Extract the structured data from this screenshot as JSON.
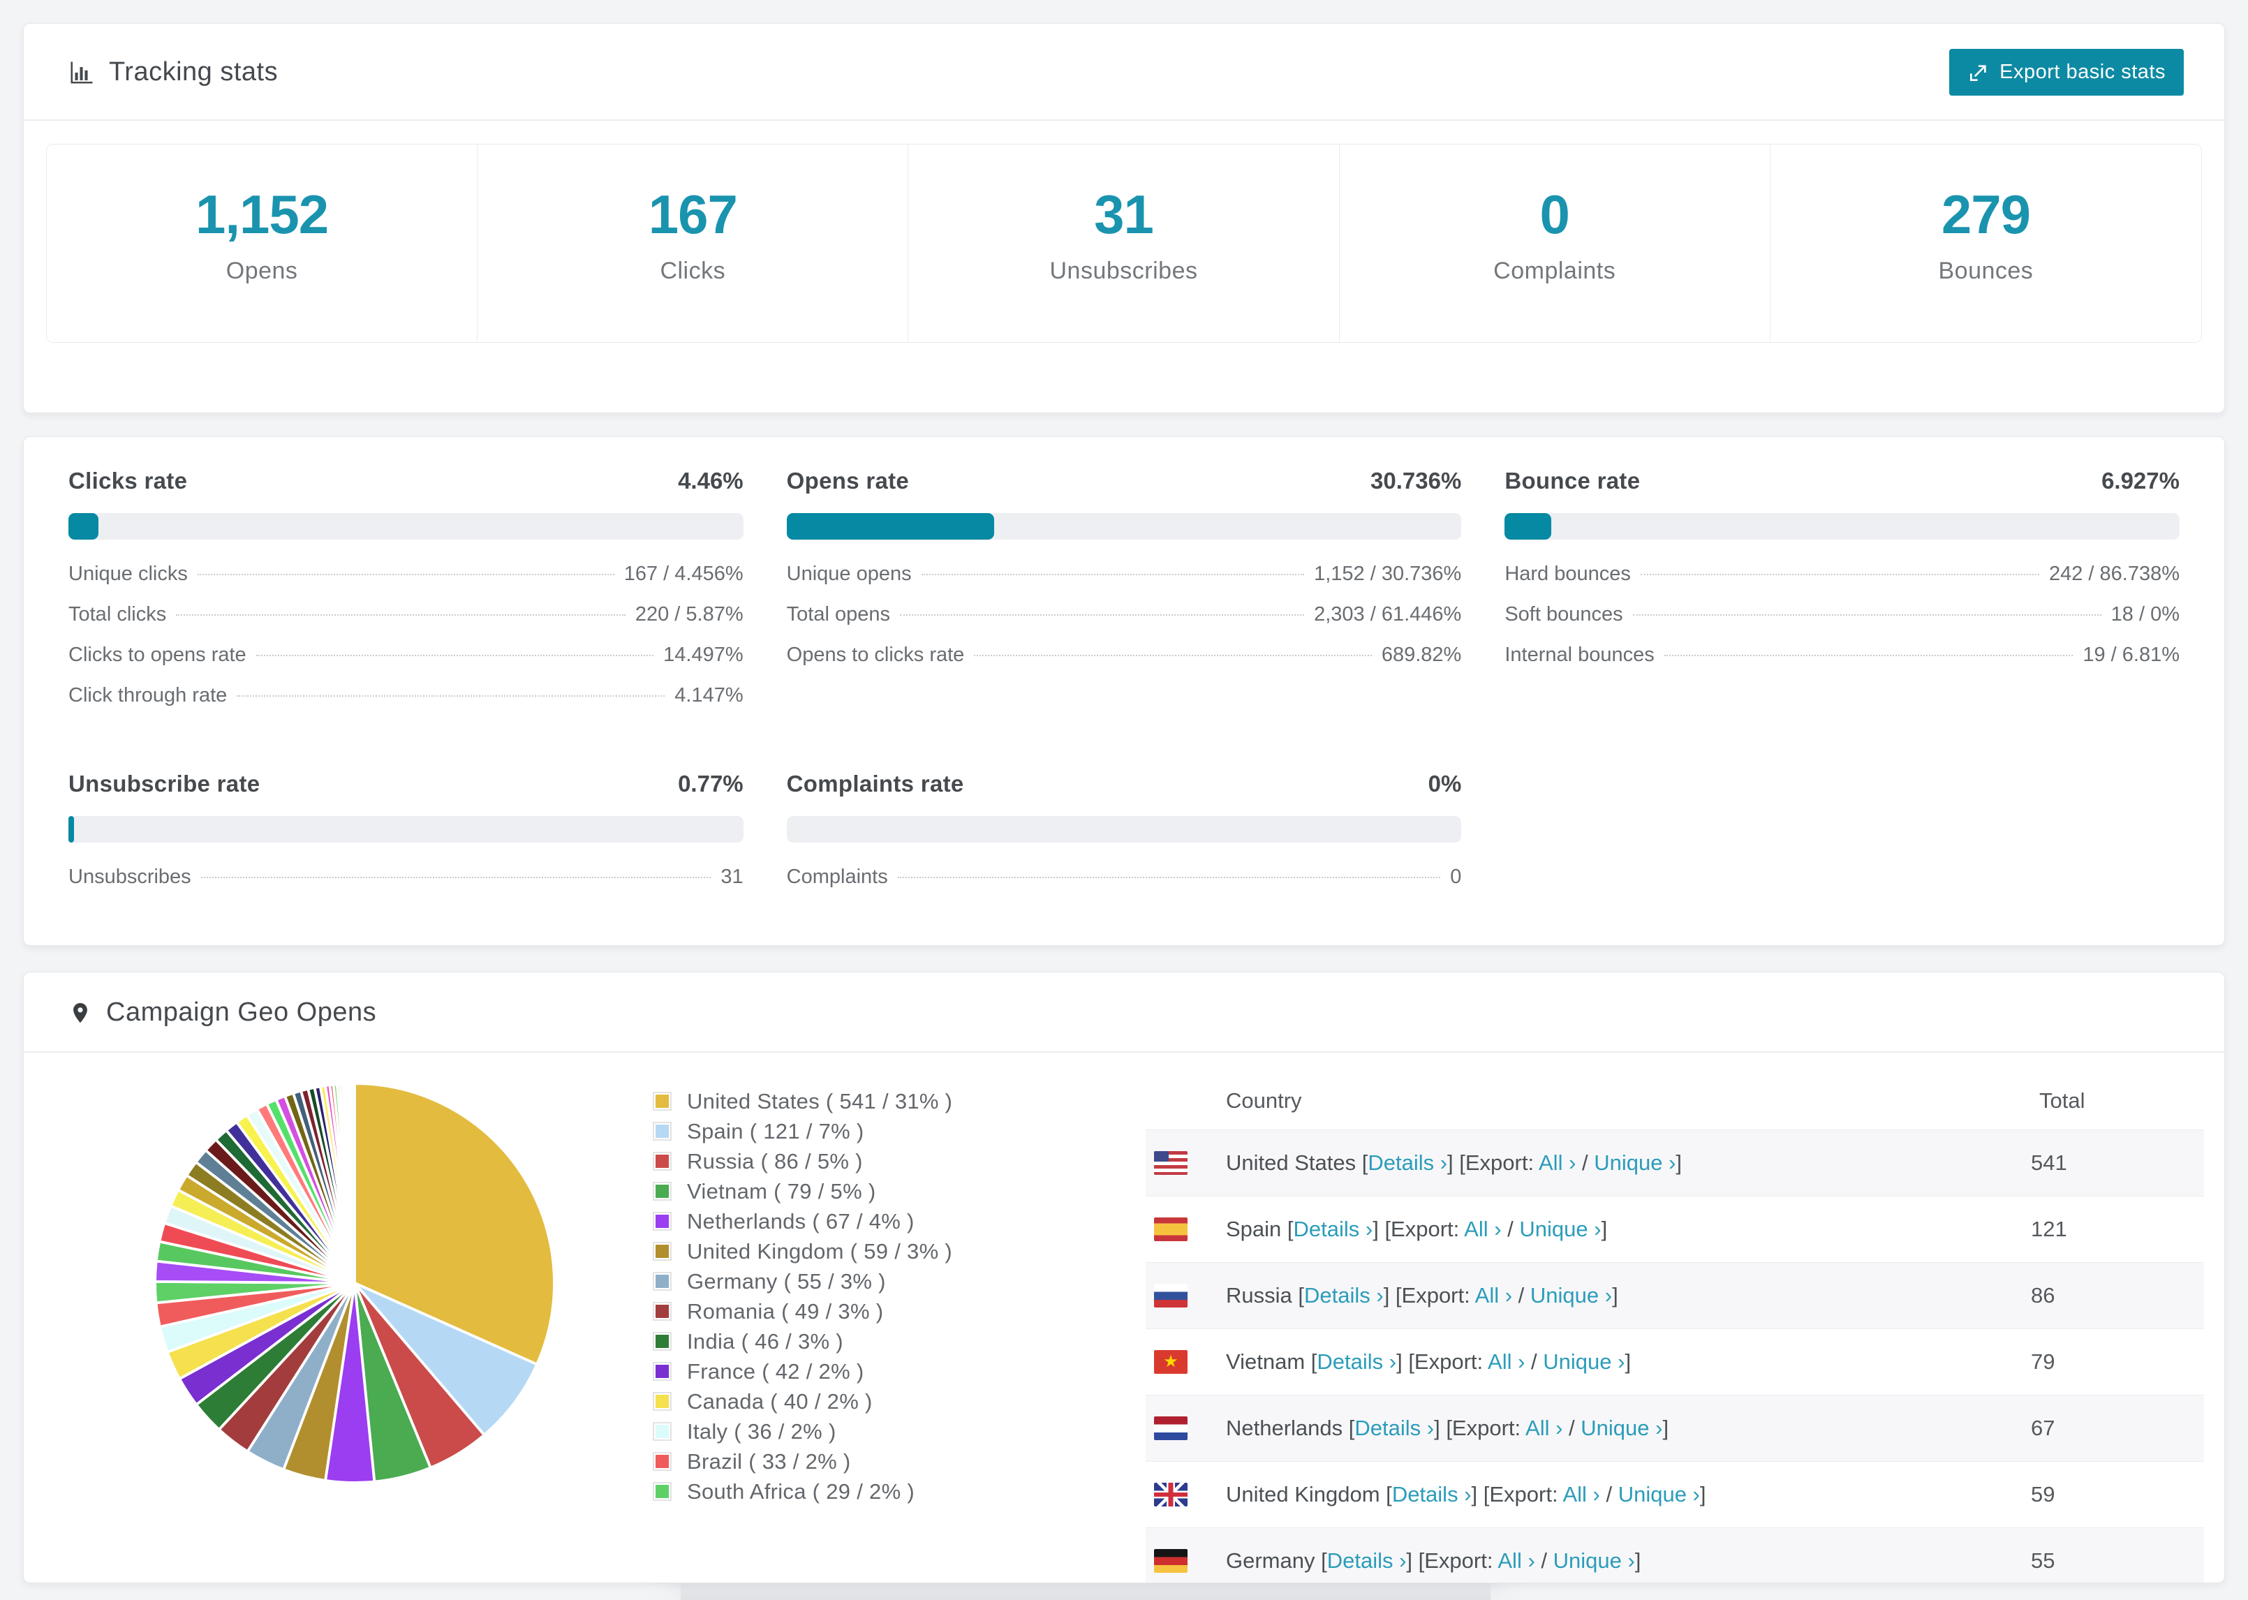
{
  "tracking": {
    "title": "Tracking stats",
    "export_label": "Export basic stats"
  },
  "stats": [
    {
      "value": "1,152",
      "label": "Opens"
    },
    {
      "value": "167",
      "label": "Clicks"
    },
    {
      "value": "31",
      "label": "Unsubscribes"
    },
    {
      "value": "0",
      "label": "Complaints"
    },
    {
      "value": "279",
      "label": "Bounces"
    }
  ],
  "rates": [
    {
      "title": "Clicks rate",
      "display": "4.46%",
      "pct": 4.46,
      "items": [
        [
          "Unique clicks",
          "167 / 4.456%"
        ],
        [
          "Total clicks",
          "220 / 5.87%"
        ],
        [
          "Clicks to opens rate",
          "14.497%"
        ],
        [
          "Click through rate",
          "4.147%"
        ]
      ]
    },
    {
      "title": "Opens rate",
      "display": "30.736%",
      "pct": 30.736,
      "items": [
        [
          "Unique opens",
          "1,152 / 30.736%"
        ],
        [
          "Total opens",
          "2,303 / 61.446%"
        ],
        [
          "Opens to clicks rate",
          "689.82%"
        ]
      ]
    },
    {
      "title": "Bounce rate",
      "display": "6.927%",
      "pct": 6.927,
      "items": [
        [
          "Hard bounces",
          "242 / 86.738%"
        ],
        [
          "Soft bounces",
          "18 / 0%"
        ],
        [
          "Internal bounces",
          "19 / 6.81%"
        ]
      ]
    },
    {
      "title": "Unsubscribe rate",
      "display": "0.77%",
      "pct": 0.77,
      "items": [
        [
          "Unsubscribes",
          "31"
        ]
      ]
    },
    {
      "title": "Complaints rate",
      "display": "0%",
      "pct": 0,
      "items": [
        [
          "Complaints",
          "0"
        ]
      ]
    }
  ],
  "geo": {
    "title": "Campaign Geo Opens",
    "legend_format": "{label} ( {value} / {pct}% )",
    "table": {
      "col_country": "Country",
      "col_total": "Total",
      "details_label": "Details ›",
      "all_label": "All ›",
      "unique_label": "Unique ›",
      "b1": " [",
      "b2": "] [Export: ",
      "b3": " / ",
      "b4": "]",
      "star_glyph": "★",
      "rows": [
        {
          "country": "United States",
          "flag": "us",
          "total": "541"
        },
        {
          "country": "Spain",
          "flag": "es",
          "total": "121"
        },
        {
          "country": "Russia",
          "flag": "ru",
          "total": "86"
        },
        {
          "country": "Vietnam",
          "flag": "vn",
          "total": "79"
        },
        {
          "country": "Netherlands",
          "flag": "nl",
          "total": "67"
        },
        {
          "country": "United Kingdom",
          "flag": "gb",
          "total": "59"
        },
        {
          "country": "Germany",
          "flag": "de",
          "total": "55"
        }
      ]
    }
  },
  "chart_data": {
    "type": "pie",
    "title": "Campaign Geo Opens",
    "legend_position": "right",
    "start_angle_deg": 0,
    "direction": "clockwise",
    "slices": [
      {
        "label": "United States",
        "value": 541,
        "pct": "31",
        "color": "#e3bb3f"
      },
      {
        "label": "Spain",
        "value": 121,
        "pct": "7",
        "color": "#b5d9f5"
      },
      {
        "label": "Russia",
        "value": 86,
        "pct": "5",
        "color": "#cb4b4b"
      },
      {
        "label": "Vietnam",
        "value": 79,
        "pct": "5",
        "color": "#4aab51"
      },
      {
        "label": "Netherlands",
        "value": 67,
        "pct": "4",
        "color": "#9b3df0"
      },
      {
        "label": "United Kingdom",
        "value": 59,
        "pct": "3",
        "color": "#b28f2e"
      },
      {
        "label": "Germany",
        "value": 55,
        "pct": "3",
        "color": "#8fafc9"
      },
      {
        "label": "Romania",
        "value": 49,
        "pct": "3",
        "color": "#a33d3d"
      },
      {
        "label": "India",
        "value": 46,
        "pct": "3",
        "color": "#2e7d36"
      },
      {
        "label": "France",
        "value": 42,
        "pct": "2",
        "color": "#7a2fd0"
      },
      {
        "label": "Canada",
        "value": 40,
        "pct": "2",
        "color": "#f5e04e"
      },
      {
        "label": "Italy",
        "value": 36,
        "pct": "2",
        "color": "#dcfbfb"
      },
      {
        "label": "Brazil",
        "value": 33,
        "pct": "2",
        "color": "#f05c5c"
      },
      {
        "label": "South Africa",
        "value": 29,
        "pct": "2",
        "color": "#5ed066"
      }
    ],
    "other_slices": [
      {
        "value": 28,
        "color": "#a64df5"
      },
      {
        "value": 27,
        "color": "#57c85f"
      },
      {
        "value": 26,
        "color": "#ef4b55"
      },
      {
        "value": 25,
        "color": "#dff6f8"
      },
      {
        "value": 24,
        "color": "#f6ee55"
      },
      {
        "value": 23,
        "color": "#caa92c"
      },
      {
        "value": 22,
        "color": "#8d7d22"
      },
      {
        "value": 21,
        "color": "#5e7f96"
      },
      {
        "value": 20,
        "color": "#6b1a1a"
      },
      {
        "value": 19,
        "color": "#1f6a35"
      },
      {
        "value": 18,
        "color": "#41309a"
      },
      {
        "value": 17,
        "color": "#f7f24e"
      },
      {
        "value": 16,
        "color": "#e7fbfb"
      },
      {
        "value": 15,
        "color": "#ff7a7a"
      },
      {
        "value": 14,
        "color": "#55e06a"
      },
      {
        "value": 13,
        "color": "#d44fe0"
      },
      {
        "value": 12,
        "color": "#726614"
      },
      {
        "value": 11,
        "color": "#43607a"
      },
      {
        "value": 10,
        "color": "#7e2230"
      },
      {
        "value": 9,
        "color": "#174a26"
      },
      {
        "value": 8,
        "color": "#2a2072"
      },
      {
        "value": 7,
        "color": "#ffe95a"
      },
      {
        "value": 6,
        "color": "#e14fd0"
      },
      {
        "value": 5,
        "color": "#f2575f"
      },
      {
        "value": 5,
        "color": "#6ede79"
      },
      {
        "value": 4,
        "color": "#e9c93e"
      },
      {
        "value": 4,
        "color": "#9fcdf2"
      },
      {
        "value": 3,
        "color": "#d9453e"
      },
      {
        "value": 3,
        "color": "#3fae57"
      },
      {
        "value": 2,
        "color": "#8a55ef"
      },
      {
        "value": 2,
        "color": "#b8962e"
      },
      {
        "value": 2,
        "color": "#ef9ff0"
      },
      {
        "value": 1,
        "color": "#c7f3f5"
      },
      {
        "value": 1,
        "color": "#f0f0a8"
      },
      {
        "value": 1,
        "color": "#d8d8f5"
      },
      {
        "value": 1,
        "color": "#efd7e5"
      }
    ]
  },
  "colors": {
    "accent_number": "#1a93ae",
    "accent_bar": "#0689a2",
    "accent_button": "#0d8aa3",
    "accent_link": "#2b9cba",
    "bar_track": "#edeff2",
    "row_stripe": "#f7f7f9"
  }
}
